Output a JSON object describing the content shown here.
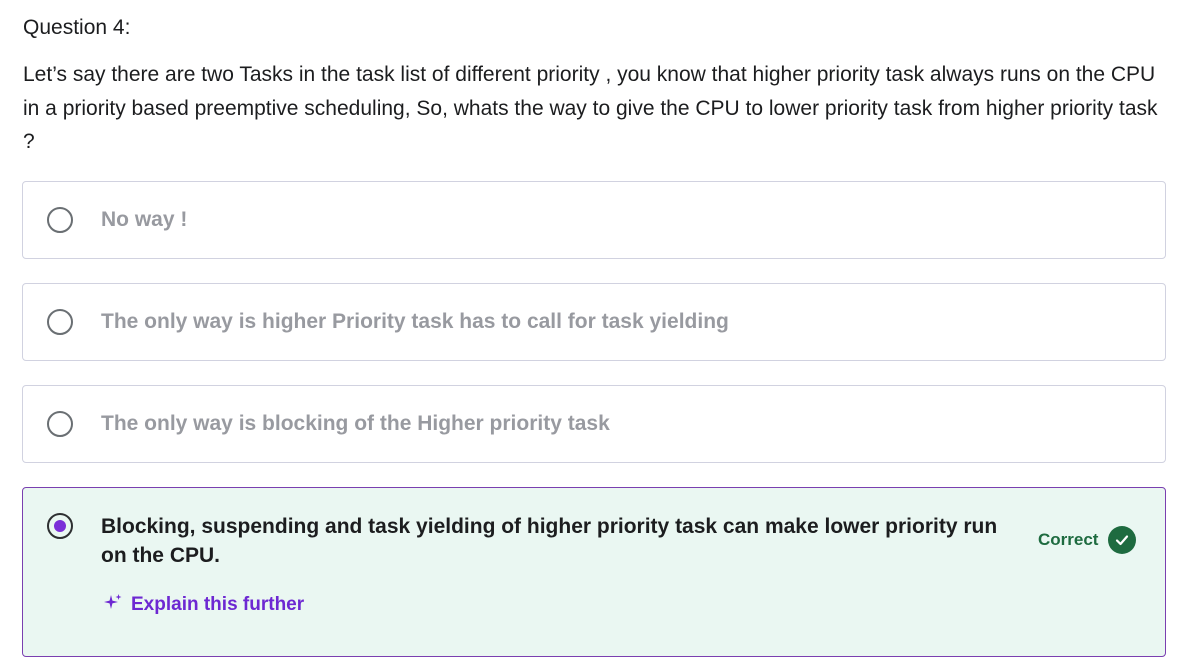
{
  "question": {
    "label": "Question 4:",
    "text": "Let’s say there are two Tasks in the task list of different priority , you know that higher priority task always runs on the CPU in  a priority based preemptive scheduling, So, whats the way to give the CPU to lower priority task from higher priority task ?"
  },
  "options": [
    {
      "label": "No way !",
      "selected": false
    },
    {
      "label": "The only way is higher Priority task has to call for task yielding",
      "selected": false
    },
    {
      "label": "The only way is blocking of the Higher priority task",
      "selected": false
    },
    {
      "label": "Blocking, suspending and task yielding of higher priority task can make lower priority run on the CPU.",
      "selected": true
    }
  ],
  "feedback": {
    "status_label": "Correct",
    "status_icon": "check-circle-icon",
    "explain_label": "Explain this further",
    "explain_icon": "sparkle-icon"
  },
  "colors": {
    "selected_bg": "#eaf7f2",
    "selected_border": "#7a3fb0",
    "accent_purple": "#6d28d2",
    "correct_green": "#1e6b40",
    "unselected_text": "#989aa0"
  }
}
